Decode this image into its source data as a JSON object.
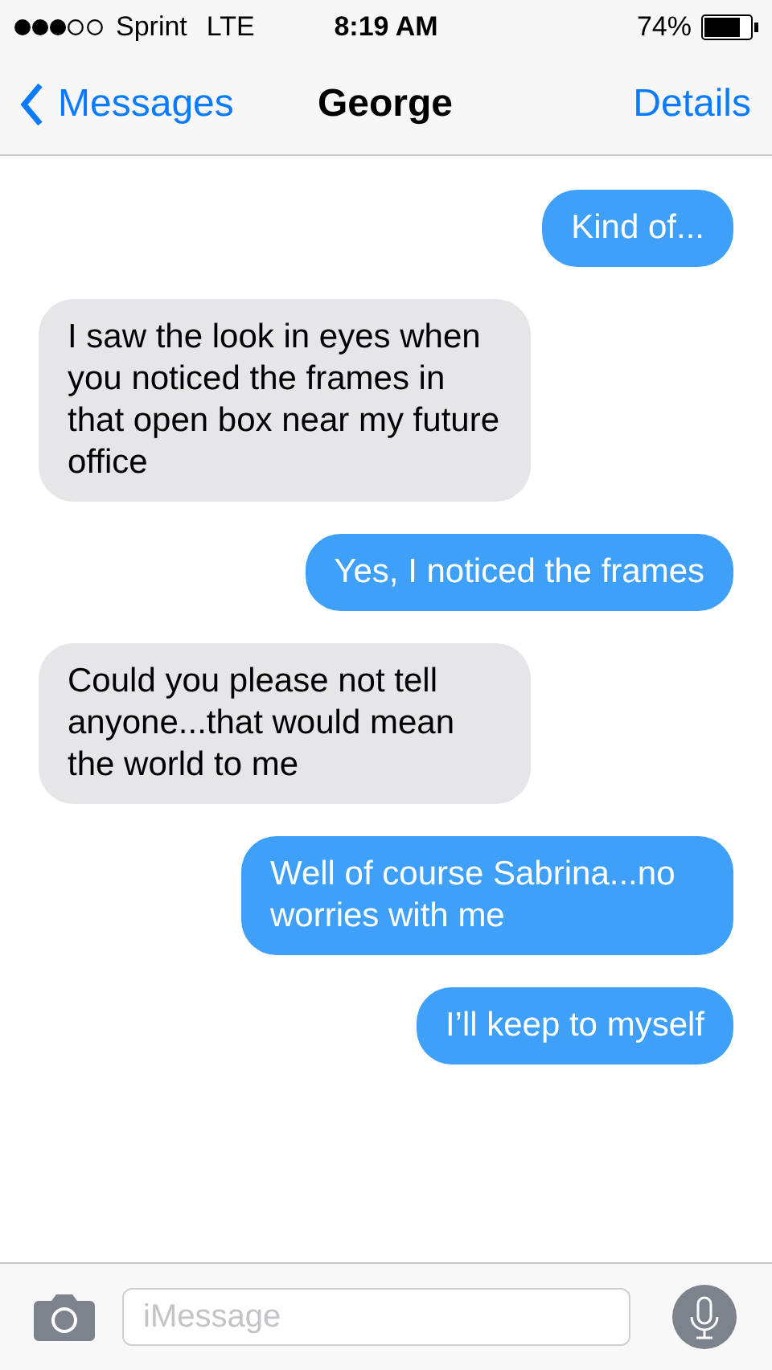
{
  "status_bar": {
    "carrier": "Sprint",
    "network": "LTE",
    "time": "8:19 AM",
    "battery_text": "74%"
  },
  "nav_bar": {
    "back_label": "Messages",
    "title": "George",
    "action": "Details"
  },
  "messages": [
    {
      "kind": "sent",
      "text": "Kind of..."
    },
    {
      "kind": "received",
      "text": "I saw the look in eyes when you noticed the frames in that open box near my future office"
    },
    {
      "kind": "sent",
      "text": "Yes, I noticed the frames"
    },
    {
      "kind": "received",
      "text": "Could you please not tell anyone...that would mean the world to me"
    },
    {
      "kind": "sent",
      "text": "Well of course Sabrina...no worries with me"
    },
    {
      "kind": "sent",
      "text": "I’ll keep to myself"
    }
  ],
  "composer": {
    "placeholder": "iMessage"
  }
}
